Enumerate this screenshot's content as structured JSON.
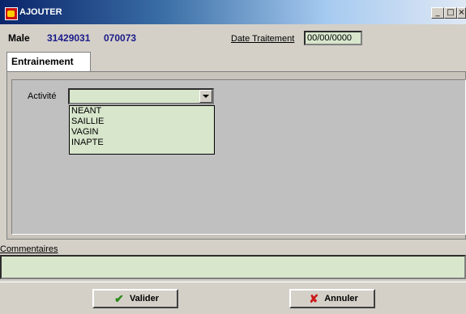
{
  "window": {
    "title": "AJOUTER"
  },
  "caption_buttons": {
    "minimize": "_",
    "maximize": "□",
    "close": "×"
  },
  "header": {
    "male_label": "Male",
    "male_id": "31429031",
    "male_number": "070073",
    "date_label": "Date Traitement",
    "date_value": "00/00/0000"
  },
  "tabs": [
    {
      "label": "Entrainement",
      "active": true
    }
  ],
  "form": {
    "activite_label": "Activité",
    "activite_value": "",
    "activite_options": [
      "NEANT",
      "SAILLIE",
      "VAGIN",
      "INAPTE"
    ]
  },
  "comments": {
    "label": "Commentaires",
    "value": ""
  },
  "buttons": {
    "valider": "Valider",
    "annuler": "Annuler"
  },
  "colors": {
    "field_bg": "#d8e6cc",
    "title_bar": "#0a246a",
    "id_text": "#1a1a8a"
  },
  "icons": {
    "valider": "checkmark-icon",
    "annuler": "cross-icon"
  }
}
